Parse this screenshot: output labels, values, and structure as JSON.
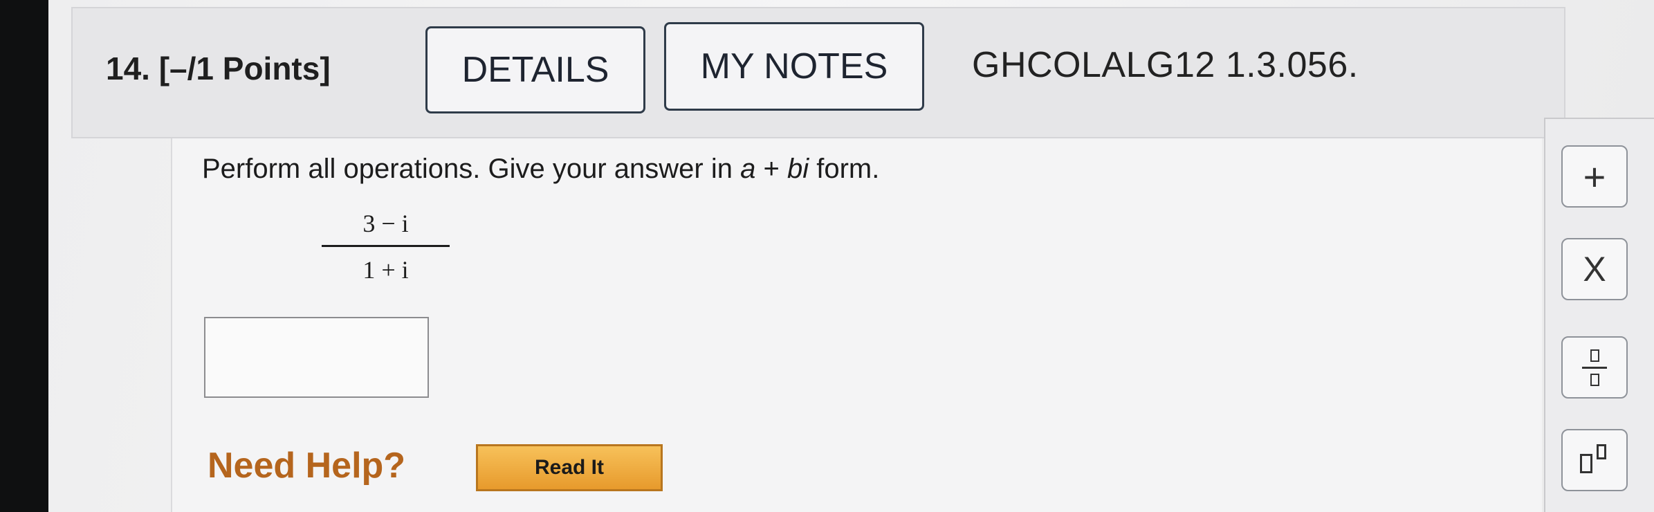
{
  "question": {
    "label": "14.  [–/1 Points]",
    "details_button": "DETAILS",
    "my_notes_button": "MY NOTES",
    "problem_id": "GHCOLALG12 1.3.056."
  },
  "problem": {
    "prompt_start": "Perform all operations. Give your answer in ",
    "prompt_a": "a",
    "prompt_plus": " + ",
    "prompt_bi": "bi",
    "prompt_end": " form.",
    "numerator": "3 − i",
    "denominator": "1 + i",
    "answer_value": ""
  },
  "help": {
    "need_help_label": "Need Help?",
    "read_it_button": "Read It"
  },
  "toolbar": {
    "plus_label": "+",
    "times_label": "X"
  },
  "colors": {
    "need_help": "#b5651d",
    "read_it_bg": "#f0ad3e",
    "button_border": "#2f3b49"
  }
}
